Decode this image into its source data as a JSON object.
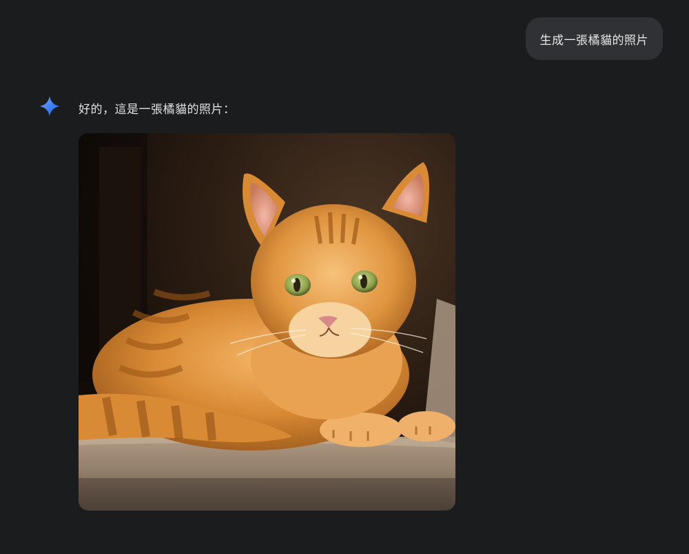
{
  "conversation": {
    "user_message": "生成一張橘貓的照片",
    "assistant_message": "好的，這是一張橘貓的照片："
  },
  "image": {
    "subject": "orange tabby cat lying on carpet",
    "icon": "orange-cat-photo"
  },
  "colors": {
    "background": "#1b1c1e",
    "user_bubble": "#303134",
    "sparkle_blue": "#4b8df8"
  }
}
